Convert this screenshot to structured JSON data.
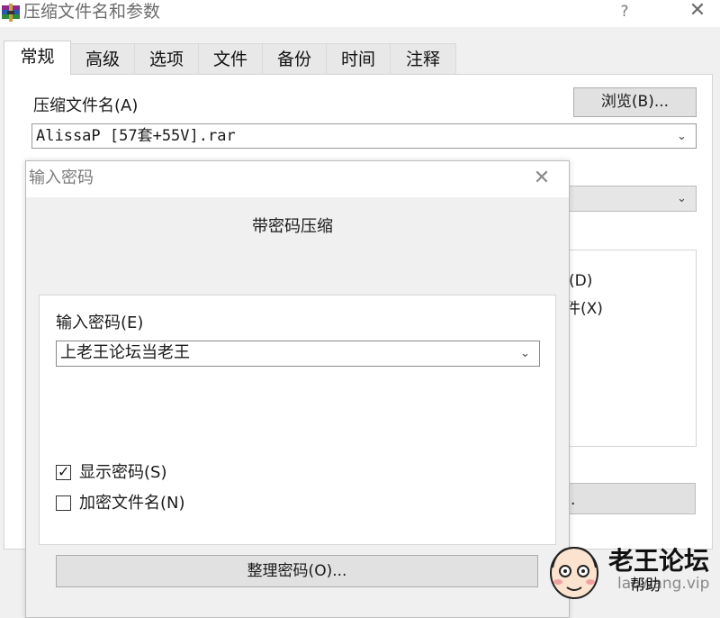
{
  "window": {
    "title": "压缩文件名和参数",
    "help_label": "?",
    "close_label": "✕"
  },
  "tabs": [
    {
      "label": "常规",
      "active": true
    },
    {
      "label": "高级",
      "active": false
    },
    {
      "label": "选项",
      "active": false
    },
    {
      "label": "文件",
      "active": false
    },
    {
      "label": "备份",
      "active": false
    },
    {
      "label": "时间",
      "active": false
    },
    {
      "label": "注释",
      "active": false
    }
  ],
  "general": {
    "archive_name_label": "压缩文件名(A)",
    "archive_name_value": "AlissaP [57套+55V].rar",
    "browse_label": "浏览(B)...",
    "partial_option_1": "(D)",
    "partial_option_2": "件(X)",
    "partial_button": "."
  },
  "password_dialog": {
    "title": "输入密码",
    "close_label": "✕",
    "heading": "带密码压缩",
    "password_label": "输入密码(E)",
    "password_value": "上老王论坛当老王",
    "show_password_label": "显示密码(S)",
    "show_password_checked": true,
    "encrypt_names_label": "加密文件名(N)",
    "encrypt_names_checked": false,
    "organize_button_label": "整理密码(O)..."
  },
  "watermark": {
    "name": "老王论坛",
    "url": "laowang.vip",
    "overlay": "帮助"
  },
  "icons": {
    "app": "winrar-books-icon",
    "dropdown": "chevron-down-icon",
    "check": "checkmark-icon"
  },
  "colors": {
    "window_bg": "#f0f0f0",
    "panel_bg": "#ffffff",
    "button_bg": "#e1e1e1",
    "title_text": "#6b6b6b"
  }
}
